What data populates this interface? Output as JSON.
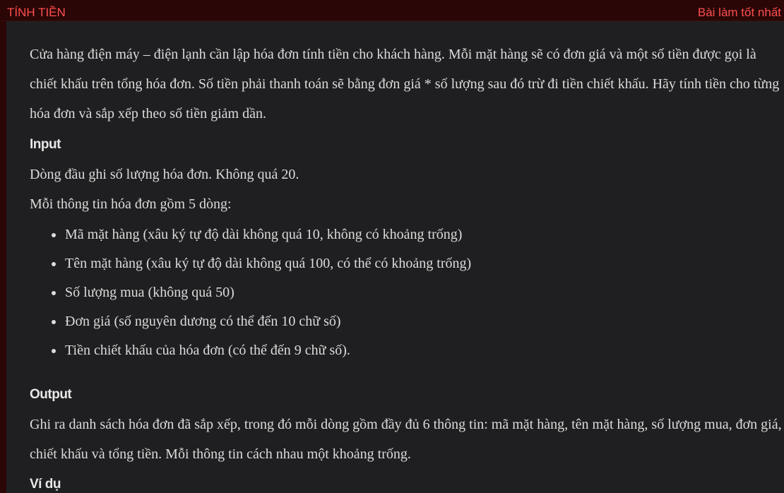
{
  "header": {
    "title": "TÍNH TIỀN",
    "best_link": "Bài làm tốt nhất"
  },
  "problem": {
    "description": "Cửa hàng điện máy – điện lạnh cần lập hóa đơn tính tiền cho khách hàng. Mỗi mặt hàng sẽ có đơn giá và một số tiền được gọi là chiết khấu trên tổng hóa đơn. Số tiền phải thanh toán sẽ bằng đơn giá * số lượng sau đó trừ đi tiền chiết khấu. Hãy tính tiền cho từng hóa đơn và sắp xếp theo số tiền giảm dần.",
    "input_heading": "Input",
    "input_line1": "Dòng đầu ghi số lượng hóa đơn. Không quá 20.",
    "input_line2": "Mỗi thông tin hóa đơn gồm 5 dòng:",
    "input_items": [
      "Mã mặt hàng (xâu ký tự độ dài không quá 10, không có khoảng trống)",
      "Tên mặt hàng (xâu ký tự độ dài không quá 100, có thể có khoảng trống)",
      "Số lượng mua (không quá 50)",
      "Đơn giá (số nguyên dương có thể đến 10 chữ số)",
      "Tiền chiết khấu của hóa đơn (có thể đến 9 chữ số)."
    ],
    "output_heading": "Output",
    "output_text": "Ghi ra danh sách hóa đơn đã sắp xếp, trong đó mỗi dòng gồm đầy đủ 6 thông tin: mã mặt hàng, tên mặt hàng, số lượng mua, đơn giá, chiết khấu và tổng tiền. Mỗi thông tin cách nhau một khoảng trống.",
    "example_heading": "Ví dụ"
  },
  "colors": {
    "accent": "#ff4f4f",
    "header_bg": "#2a0606",
    "content_bg": "#1f1f21",
    "text": "#dcdcdc"
  }
}
